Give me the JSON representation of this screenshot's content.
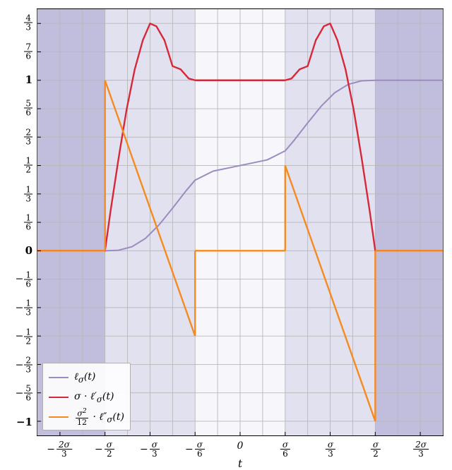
{
  "chart_data": {
    "type": "line",
    "title": "",
    "xlabel": "t",
    "ylabel": "",
    "xlim": [
      -0.75,
      0.75
    ],
    "ylim": [
      -1.083,
      1.417
    ],
    "x_tick_values": [
      -0.6667,
      -0.5,
      -0.3333,
      -0.1667,
      0,
      0.1667,
      0.3333,
      0.5,
      0.6667
    ],
    "x_tick_labels": [
      "-2σ/3",
      "-σ/2",
      "-σ/3",
      "-σ/6",
      "0",
      "σ/6",
      "σ/3",
      "σ/2",
      "2σ/3"
    ],
    "y_tick_values": [
      -1,
      -0.8333,
      -0.6667,
      -0.5,
      -0.3333,
      -0.1667,
      0,
      0.1667,
      0.3333,
      0.5,
      0.6667,
      0.8333,
      1,
      1.1667,
      1.3333
    ],
    "y_tick_labels": [
      "-1",
      "-5/6",
      "-2/3",
      "-1/2",
      "-1/3",
      "-1/6",
      "0",
      "1/6",
      "1/3",
      "1/2",
      "2/3",
      "5/6",
      "1",
      "7/6",
      "4/3"
    ],
    "legend_position": "lower left",
    "grid": true,
    "background_bands": [
      {
        "x_range": [
          -0.75,
          -0.5
        ],
        "color": "#8d89c0",
        "alpha": 0.55
      },
      {
        "x_range": [
          -0.5,
          -0.1667
        ],
        "color": "#8d89c0",
        "alpha": 0.25
      },
      {
        "x_range": [
          -0.1667,
          0.1667
        ],
        "color": "#8d89c0",
        "alpha": 0.07
      },
      {
        "x_range": [
          0.1667,
          0.5
        ],
        "color": "#8d89c0",
        "alpha": 0.25
      },
      {
        "x_range": [
          0.5,
          0.75
        ],
        "color": "#8d89c0",
        "alpha": 0.55
      }
    ],
    "series": [
      {
        "name": "ℓ_σ(t)",
        "color": "#9b8bbf",
        "linewidth": 2,
        "x": [
          -0.75,
          -0.5,
          -0.45,
          -0.4,
          -0.35,
          -0.3,
          -0.25,
          -0.2,
          -0.1667,
          -0.1,
          0.0,
          0.1,
          0.1667,
          0.2,
          0.25,
          0.3,
          0.35,
          0.4,
          0.45,
          0.5,
          0.75
        ],
        "y": [
          0.0,
          0.0,
          0.003,
          0.024,
          0.073,
          0.152,
          0.25,
          0.352,
          0.414,
          0.467,
          0.5,
          0.533,
          0.586,
          0.648,
          0.75,
          0.848,
          0.927,
          0.976,
          0.997,
          1.0,
          1.0
        ]
      },
      {
        "name": "σ·ℓ′_σ(t)",
        "color": "#d62839",
        "linewidth": 2.4,
        "x": [
          -0.75,
          -0.5,
          -0.48,
          -0.45,
          -0.42,
          -0.39,
          -0.36,
          -0.3333,
          -0.31,
          -0.28,
          -0.25,
          -0.22,
          -0.19,
          -0.1667,
          0.1667,
          0.19,
          0.22,
          0.25,
          0.28,
          0.31,
          0.3333,
          0.36,
          0.39,
          0.42,
          0.45,
          0.48,
          0.5,
          0.75
        ],
        "y": [
          0.0,
          0.0,
          0.227,
          0.54,
          0.829,
          1.064,
          1.235,
          1.333,
          1.317,
          1.235,
          1.083,
          1.064,
          1.01,
          1.0,
          1.0,
          1.01,
          1.064,
          1.083,
          1.235,
          1.317,
          1.333,
          1.235,
          1.064,
          0.829,
          0.54,
          0.227,
          0.0,
          0.0
        ]
      },
      {
        "name": "(σ²/12)·ℓ″_σ(t)",
        "color": "#f58b1f",
        "linewidth": 2.4,
        "piecewise": true,
        "segments": [
          {
            "x": [
              -0.75,
              -0.5
            ],
            "y": [
              0.0,
              0.0
            ]
          },
          {
            "x": [
              -0.5,
              -0.5
            ],
            "y": [
              0.0,
              1.0
            ]
          },
          {
            "x": [
              -0.5,
              -0.1667
            ],
            "y": [
              1.0,
              -0.5
            ]
          },
          {
            "x": [
              -0.1667,
              -0.1667
            ],
            "y": [
              -0.5,
              0.0
            ]
          },
          {
            "x": [
              -0.1667,
              0.1667
            ],
            "y": [
              0.0,
              0.0
            ]
          },
          {
            "x": [
              0.1667,
              0.1667
            ],
            "y": [
              0.0,
              0.5
            ]
          },
          {
            "x": [
              0.1667,
              0.5
            ],
            "y": [
              0.5,
              -1.0
            ]
          },
          {
            "x": [
              0.5,
              0.5
            ],
            "y": [
              -1.0,
              0.0
            ]
          },
          {
            "x": [
              0.5,
              0.75
            ],
            "y": [
              0.0,
              0.0
            ]
          }
        ]
      }
    ]
  },
  "legend": {
    "entries": [
      {
        "label_html": "ℓ<sub>σ</sub>(t)",
        "color": "#9b8bbf",
        "lw": 2
      },
      {
        "label_html": "σ · ℓ′<sub>σ</sub>(t)",
        "color": "#d62839",
        "lw": 2.4
      },
      {
        "label_html": "<span class='frac'><span class='num'>σ<sup>2</sup></span><span class='den'>12</span></span> · ℓ″<sub>σ</sub>(t)",
        "color": "#f58b1f",
        "lw": 2.4
      }
    ]
  },
  "xlabel": "t"
}
